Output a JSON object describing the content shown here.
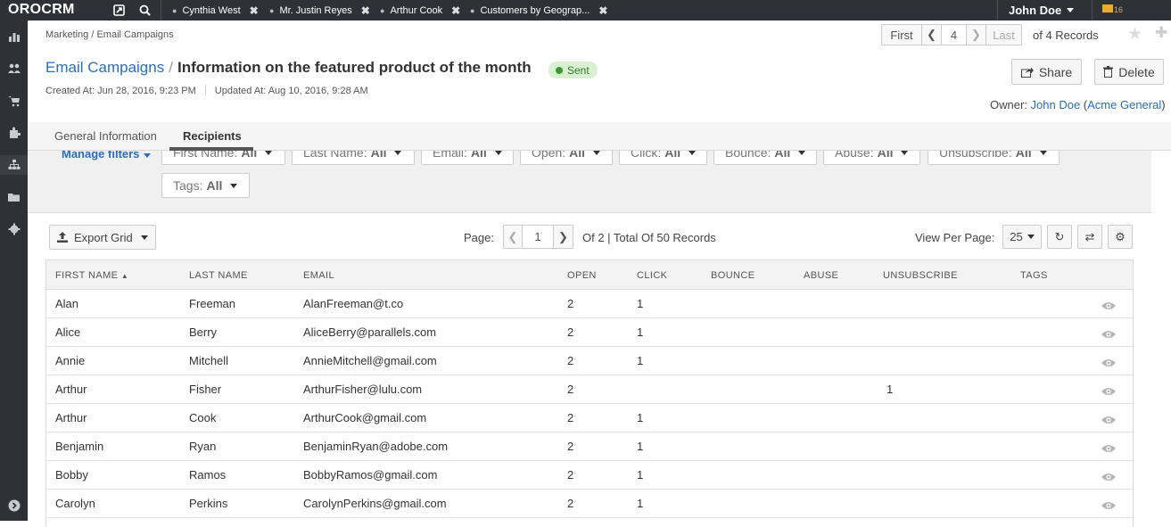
{
  "app": {
    "logo": "OROCRM"
  },
  "topbar": {
    "tabs": [
      {
        "label": "Cynthia West"
      },
      {
        "label": "Mr. Justin Reyes"
      },
      {
        "label": "Arthur Cook"
      },
      {
        "label": "Customers by Geograp..."
      }
    ],
    "user": "John Doe",
    "mail_count": "16"
  },
  "breadcrumb": "Marketing / Email Campaigns",
  "record_pager": {
    "first": "First",
    "current": "4",
    "last": "Last",
    "count": "of 4 Records"
  },
  "header": {
    "parent": "Email Campaigns",
    "sep": "/",
    "title": "Information on the featured product of the month",
    "status": "Sent",
    "created": "Created At: Jun 28, 2016, 9:23 PM",
    "updated": "Updated At: Aug 10, 2016, 9:28 AM",
    "share": "Share",
    "delete": "Delete",
    "owner_label": "Owner:",
    "owner_name": "John Doe",
    "owner_org": "Acme General"
  },
  "tabs": [
    {
      "label": "General Information"
    },
    {
      "label": "Recipients"
    }
  ],
  "filters": {
    "manage": "Manage filters",
    "items": [
      {
        "label": "First Name:",
        "value": "All"
      },
      {
        "label": "Last Name:",
        "value": "All"
      },
      {
        "label": "Email:",
        "value": "All"
      },
      {
        "label": "Open:",
        "value": "All"
      },
      {
        "label": "Click:",
        "value": "All"
      },
      {
        "label": "Bounce:",
        "value": "All"
      },
      {
        "label": "Abuse:",
        "value": "All"
      },
      {
        "label": "Unsubscribe:",
        "value": "All"
      },
      {
        "label": "Tags:",
        "value": "All"
      }
    ]
  },
  "grid_toolbar": {
    "export": "Export Grid",
    "page_label": "Page:",
    "page": "1",
    "total": "Of 2 | Total Of 50 Records",
    "view_per_page": "View Per Page:",
    "per_page": "25"
  },
  "grid": {
    "columns": [
      "FIRST NAME",
      "LAST NAME",
      "EMAIL",
      "OPEN",
      "CLICK",
      "BOUNCE",
      "ABUSE",
      "UNSUBSCRIBE",
      "TAGS"
    ],
    "rows": [
      {
        "first": "Alan",
        "last": "Freeman",
        "email": "AlanFreeman@t.co",
        "open": "2",
        "click": "1",
        "bounce": "",
        "abuse": "",
        "unsub": "",
        "tags": ""
      },
      {
        "first": "Alice",
        "last": "Berry",
        "email": "AliceBerry@parallels.com",
        "open": "2",
        "click": "1",
        "bounce": "",
        "abuse": "",
        "unsub": "",
        "tags": ""
      },
      {
        "first": "Annie",
        "last": "Mitchell",
        "email": "AnnieMitchell@gmail.com",
        "open": "2",
        "click": "1",
        "bounce": "",
        "abuse": "",
        "unsub": "",
        "tags": ""
      },
      {
        "first": "Arthur",
        "last": "Fisher",
        "email": "ArthurFisher@lulu.com",
        "open": "2",
        "click": "",
        "bounce": "",
        "abuse": "",
        "unsub": "1",
        "tags": ""
      },
      {
        "first": "Arthur",
        "last": "Cook",
        "email": "ArthurCook@gmail.com",
        "open": "2",
        "click": "1",
        "bounce": "",
        "abuse": "",
        "unsub": "",
        "tags": ""
      },
      {
        "first": "Benjamin",
        "last": "Ryan",
        "email": "BenjaminRyan@adobe.com",
        "open": "2",
        "click": "1",
        "bounce": "",
        "abuse": "",
        "unsub": "",
        "tags": ""
      },
      {
        "first": "Bobby",
        "last": "Ramos",
        "email": "BobbyRamos@gmail.com",
        "open": "2",
        "click": "1",
        "bounce": "",
        "abuse": "",
        "unsub": "",
        "tags": ""
      },
      {
        "first": "Carolyn",
        "last": "Perkins",
        "email": "CarolynPerkins@gmail.com",
        "open": "2",
        "click": "1",
        "bounce": "",
        "abuse": "",
        "unsub": "",
        "tags": ""
      }
    ]
  }
}
